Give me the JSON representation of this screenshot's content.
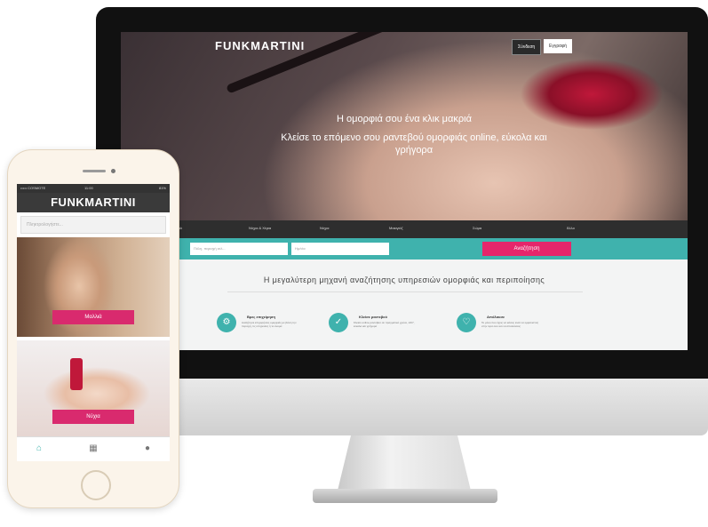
{
  "desktop": {
    "brand": "FUNKMARTINI",
    "header_buttons": {
      "login": "Σύνδεση",
      "register": "Εγγραφή"
    },
    "hero_title": "Η ομορφιά σου ένα κλικ μακριά",
    "hero_subtitle": "Κλείσε το επόμενο σου ραντεβού ομορφιάς online, εύκολα και γρήγορα",
    "categories": [
      "Μαλλιά",
      "Νύχια & Χέρια",
      "Νύχια",
      "Μακιγιάζ",
      "Σώμα",
      "Άλλο"
    ],
    "search": {
      "location_placeholder": "Πόλη, περιοχή κτλ...",
      "date_placeholder": "Ημ/νία",
      "button": "Αναζήτηση"
    },
    "tagline": "Η μεγαλύτερη μηχανή αναζήτησης υπηρεσιών ομορφιάς και περιποίησης",
    "features": [
      {
        "title": "Βρες επιχείρηση",
        "text": "Αναζήτησε επιχειρήσεις ομορφιάς με βάση την περιοχή, τις υπηρεσίες ή το όνομα"
      },
      {
        "title": "Κλείσε ραντεβού",
        "text": "Κλείσε online ραντεβού σε πραγματικό χρόνο, 24/7, εύκολα και γρήγορα"
      },
      {
        "title": "Απόλαυσε",
        "text": "Το μόνο που έχεις να κάνεις είναι να εμφανιστείς στην ώρα σου και να απολαύσεις"
      }
    ],
    "accent_color": "#3fb2ad",
    "cta_color": "#e5266b"
  },
  "mobile": {
    "status_bar": {
      "carrier": "••••• COSMOTE",
      "time": "11:00",
      "battery": "81%"
    },
    "brand": "FUNKMARTINI",
    "search_placeholder": "Πληκτρολογήστε...",
    "cards": [
      {
        "label": "Μαλλιά"
      },
      {
        "label": "Νύχια"
      }
    ],
    "tabs": [
      "home-icon",
      "calendar-icon",
      "user-icon"
    ],
    "accent_color": "#d92a6e"
  }
}
